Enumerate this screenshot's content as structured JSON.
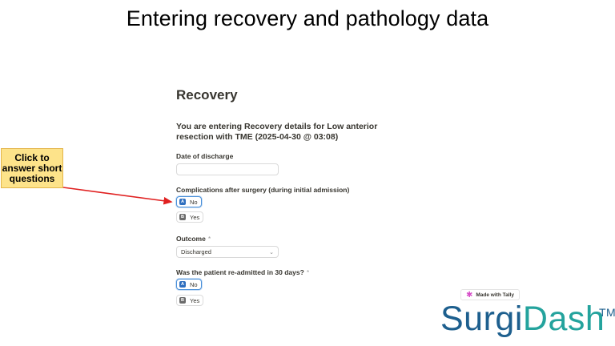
{
  "slide": {
    "title": "Entering recovery and pathology data"
  },
  "form": {
    "title": "Recovery",
    "intro": "You are entering Recovery details for Low anterior resection with TME (2025-04-30 @ 03:08)",
    "discharge": {
      "label": "Date of discharge",
      "value": ""
    },
    "complications": {
      "label": "Complications after surgery (during initial admission)",
      "options": [
        {
          "key": "A",
          "label": "No",
          "selected": true
        },
        {
          "key": "B",
          "label": "Yes",
          "selected": false
        }
      ]
    },
    "outcome": {
      "label": "Outcome",
      "required_mark": "*",
      "value": "Discharged"
    },
    "readmitted": {
      "label": "Was the patient re-admitted in 30 days?",
      "required_mark": "*",
      "options": [
        {
          "key": "A",
          "label": "No",
          "selected": true
        },
        {
          "key": "B",
          "label": "Yes",
          "selected": false
        }
      ]
    }
  },
  "callout": {
    "text": "Click to answer short questions"
  },
  "tally_badge": {
    "label": "Made with Tally",
    "icon": "tally-star-icon"
  },
  "logo": {
    "part1": "Surgi",
    "part2": "Dash",
    "tm": "TM"
  },
  "colors": {
    "accent": "#2f6fbf",
    "callout_bg": "#fde38a",
    "arrow": "#e02020",
    "logo_blue": "#1d5f8e",
    "logo_teal": "#24a39d"
  }
}
